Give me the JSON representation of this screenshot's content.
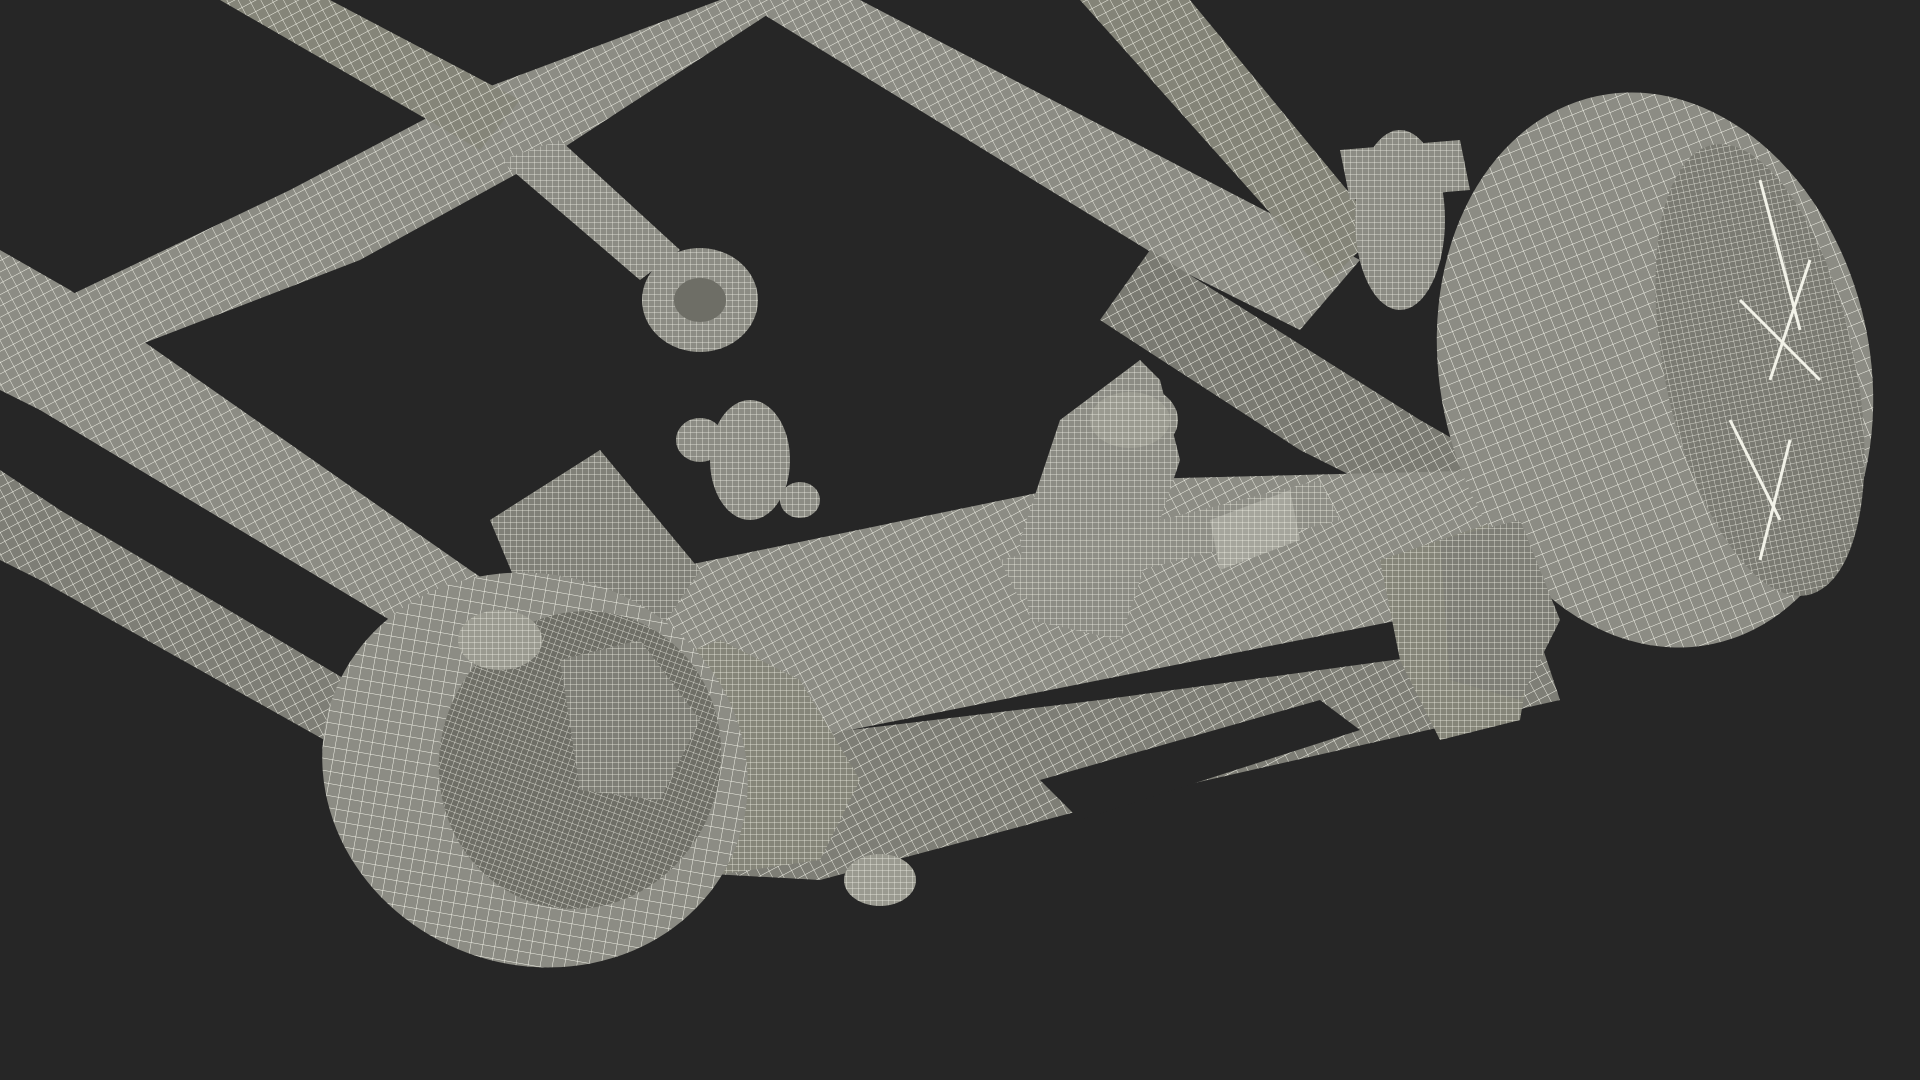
{
  "render": {
    "subject": "chassis-wireframe",
    "colors": {
      "background": "#262626",
      "surface": "#8c8c84",
      "surface_dark": "#6e6e66",
      "wire": "#f2f2e8"
    }
  }
}
